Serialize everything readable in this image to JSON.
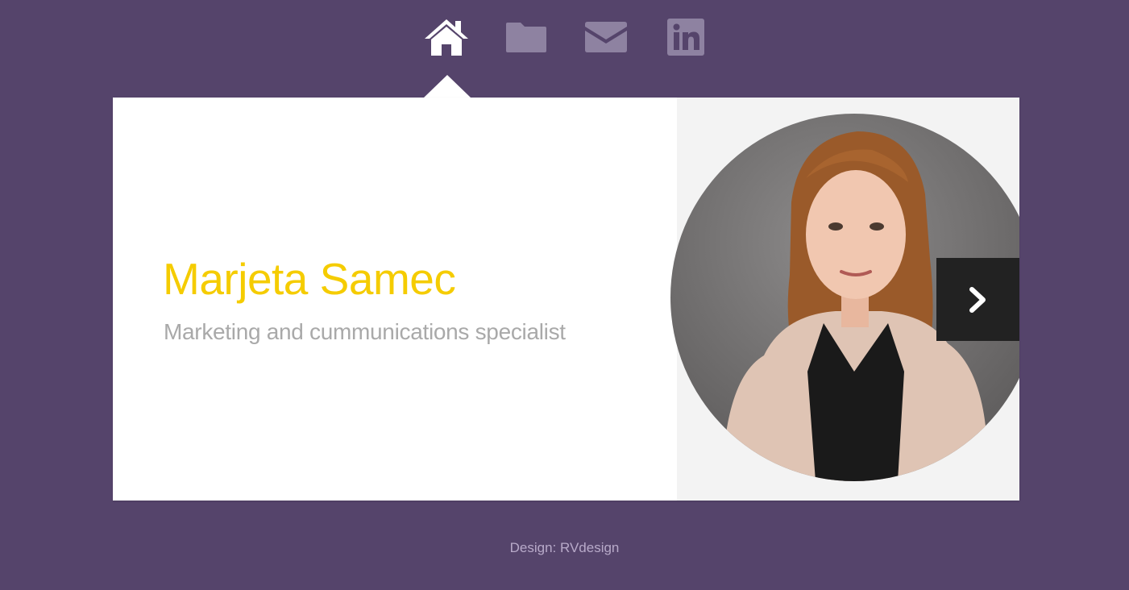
{
  "nav": {
    "items": [
      {
        "icon": "home-icon",
        "active": true
      },
      {
        "icon": "folder-icon",
        "active": false
      },
      {
        "icon": "mail-icon",
        "active": false
      },
      {
        "icon": "linkedin-icon",
        "active": false
      }
    ]
  },
  "profile": {
    "name": "Marjeta Samec",
    "title": "Marketing and cummunications specialist"
  },
  "slider": {
    "next_icon": "chevron-right-icon"
  },
  "footer": {
    "credit": "Design: RVdesign"
  },
  "colors": {
    "background": "#55446b",
    "accent": "#f5cc00",
    "nav_active": "#ffffff",
    "nav_inactive": "#8e82a1",
    "card": "#ffffff",
    "subtitle": "#a9a9a9",
    "button": "#222222"
  }
}
